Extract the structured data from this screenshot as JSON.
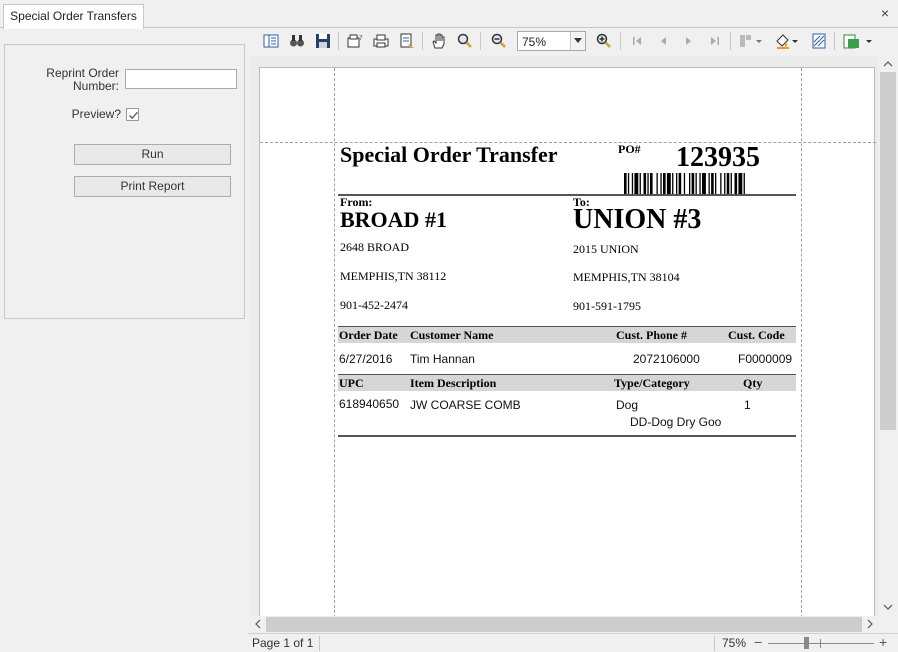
{
  "tab": {
    "title": "Special Order Transfers",
    "close_glyph": "×"
  },
  "params": {
    "reprint_label": "Reprint Order Number:",
    "reprint_value": "",
    "preview_label": "Preview?",
    "preview_checked": true,
    "run_label": "Run",
    "print_label": "Print Report"
  },
  "toolbar": {
    "icons": [
      "toggle-sidebar-icon",
      "find-icon",
      "save-icon",
      "page-setup-icon",
      "print-icon",
      "quick-print-icon",
      "hand-tool-icon",
      "magnifier-icon",
      "zoom-out-icon",
      "zoom-in-icon",
      "first-page-icon",
      "previous-page-icon",
      "next-page-icon",
      "last-page-icon",
      "multipage-icon",
      "background-color-icon",
      "watermark-icon",
      "export-icon"
    ],
    "zoom_value": "75%"
  },
  "report": {
    "title": "Special Order Transfer",
    "po_label": "PO#",
    "po_number": "123935",
    "from_label": "From:",
    "from_name": "BROAD #1",
    "from_address": "2648 BROAD",
    "from_city": "MEMPHIS,TN 38112",
    "from_phone": "901-452-2474",
    "to_label": "To:",
    "to_name": "UNION #3",
    "to_address": "2015 UNION",
    "to_city": "MEMPHIS,TN 38104",
    "to_phone": "901-591-1795",
    "order_headers": [
      "Order Date",
      "Customer Name",
      "Cust. Phone #",
      "Cust. Code"
    ],
    "order_row": [
      "6/27/2016",
      "Tim Hannan",
      "2072106000",
      "F0000009"
    ],
    "item_headers": [
      "UPC",
      "Item Description",
      "Type/Category",
      "Qty"
    ],
    "item_row": [
      "618940650",
      "JW COARSE COMB",
      "Dog",
      "1"
    ],
    "item_subcategory": "DD-Dog Dry Goo"
  },
  "status": {
    "page_text": "Page 1 of 1",
    "zoom_text": "75%",
    "zoom_minus": "−",
    "zoom_plus": "+"
  }
}
